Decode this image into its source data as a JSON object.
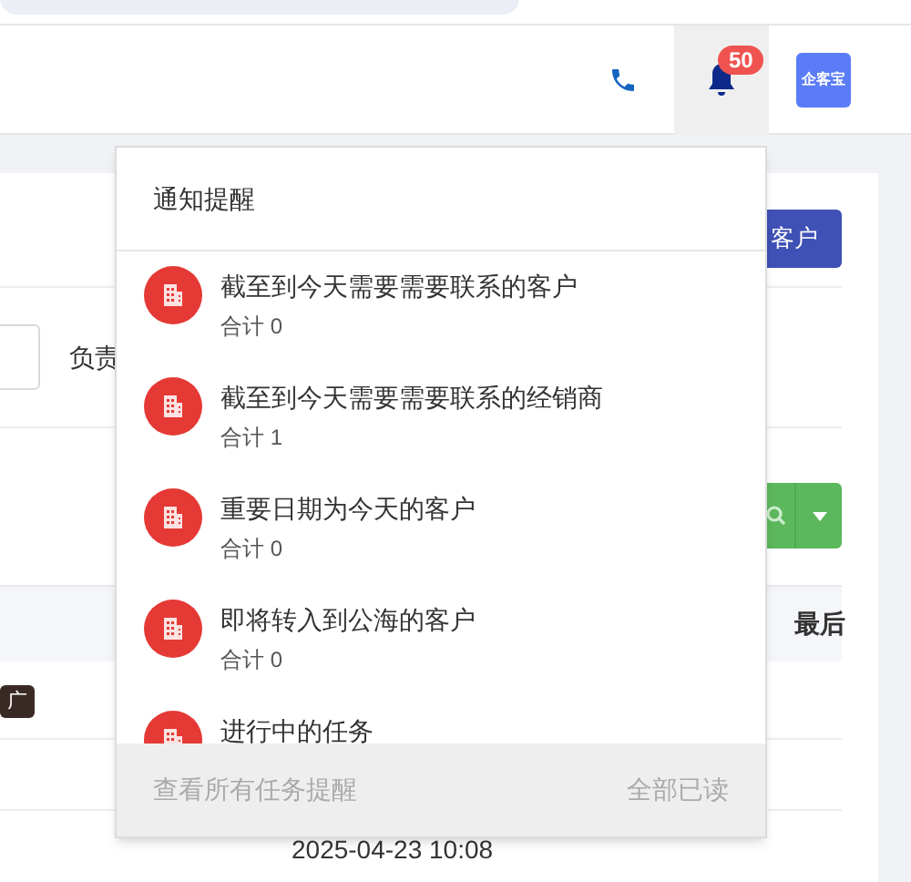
{
  "header": {
    "badge": "50",
    "logo": "企客宝",
    "bell_active": true
  },
  "background": {
    "button": "客户",
    "filter_label": "负责",
    "tag": "广",
    "column": "最后",
    "date": "2025-04-23 10:08"
  },
  "notifications": {
    "title": "通知提醒",
    "items": [
      {
        "title": "截至到今天需要需要联系的客户",
        "count": "合计 0"
      },
      {
        "title": "截至到今天需要需要联系的经销商",
        "count": "合计 1"
      },
      {
        "title": "重要日期为今天的客户",
        "count": "合计 0"
      },
      {
        "title": "即将转入到公海的客户",
        "count": "合计 0"
      },
      {
        "title": "进行中的任务"
      }
    ],
    "footer": {
      "view_all": "查看所有任务提醒",
      "mark_all_read": "全部已读",
      "disabled": true
    }
  }
}
